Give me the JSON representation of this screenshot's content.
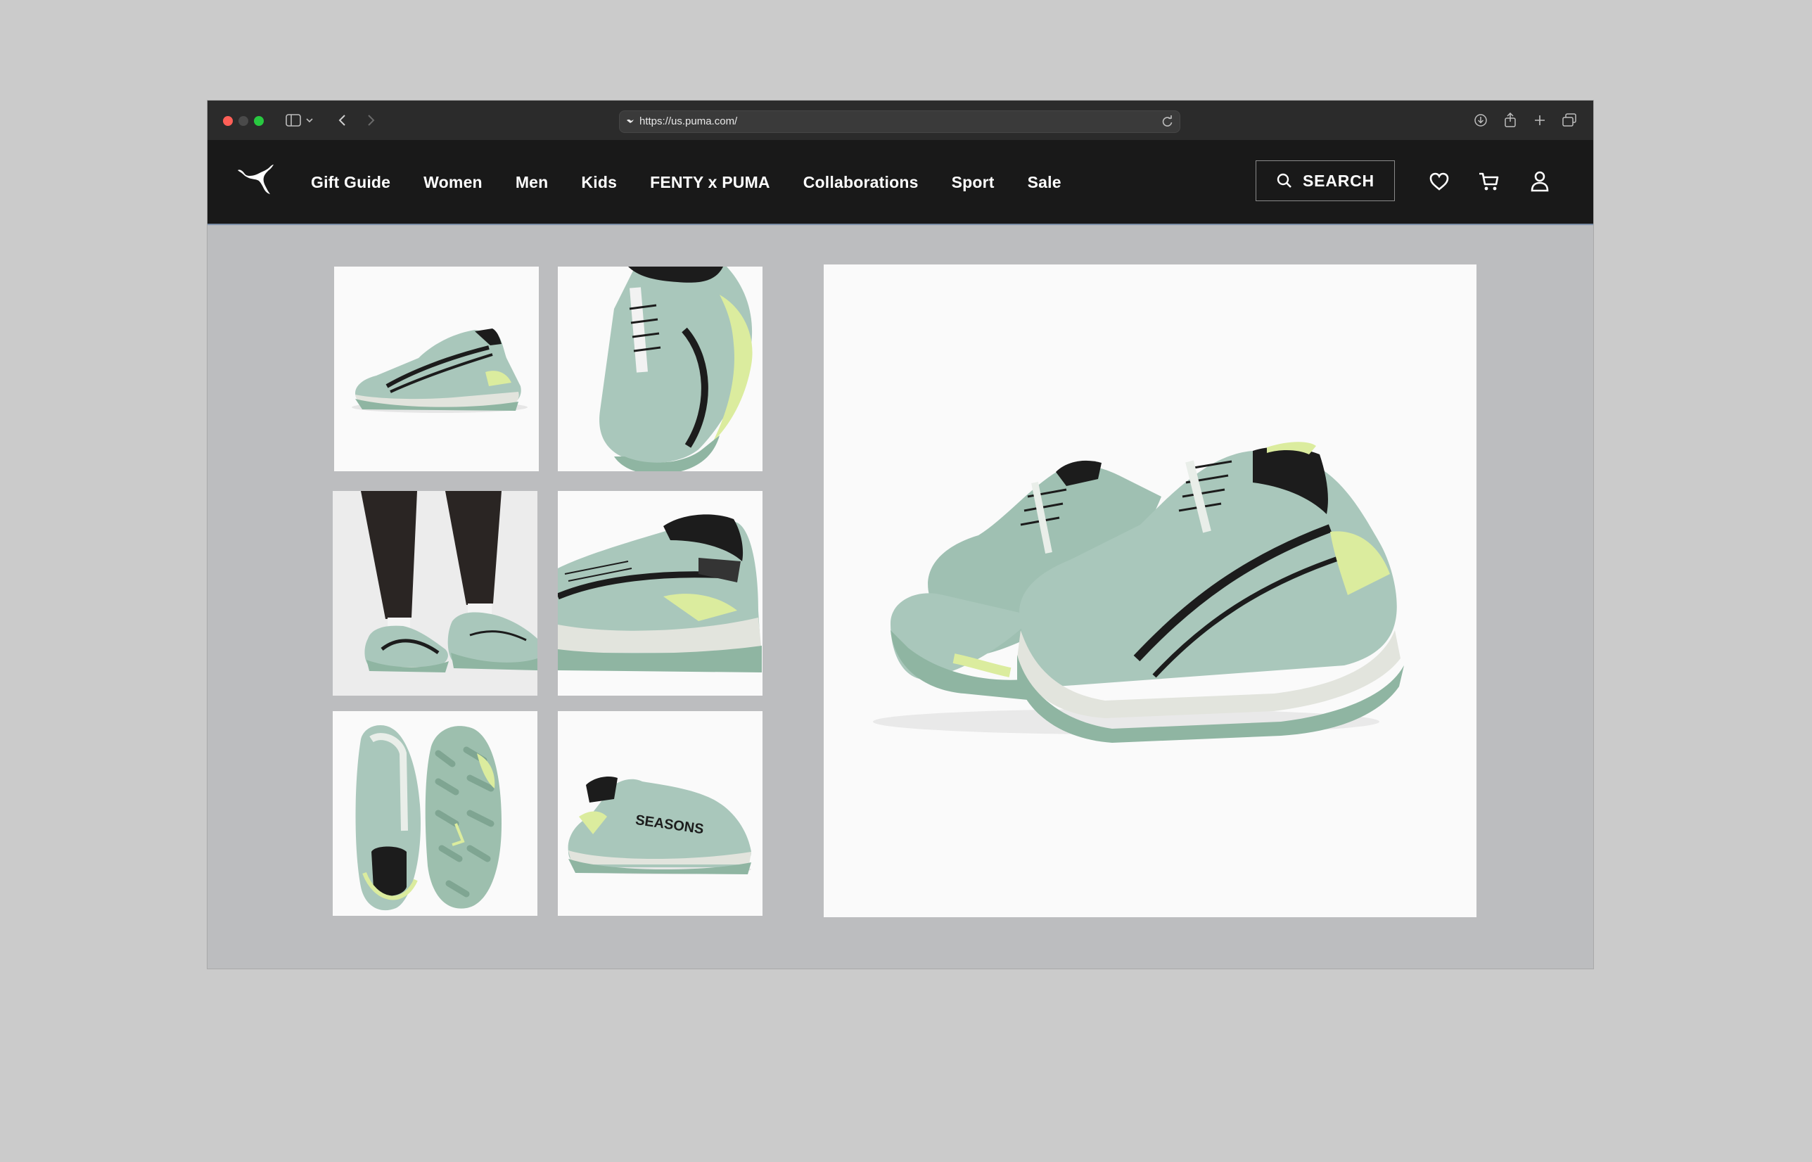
{
  "browser": {
    "url": "https://us.puma.com/"
  },
  "header": {
    "logo": "puma-logo",
    "nav": [
      {
        "label": "Gift Guide"
      },
      {
        "label": "Women"
      },
      {
        "label": "Men"
      },
      {
        "label": "Kids"
      },
      {
        "label": "FENTY x PUMA"
      },
      {
        "label": "Collaborations"
      },
      {
        "label": "Sport"
      },
      {
        "label": "Sale"
      }
    ],
    "search_label": "SEARCH",
    "icons": [
      "heart-icon",
      "cart-icon",
      "account-icon"
    ]
  },
  "gallery": {
    "thumbnails": [
      {
        "view": "side-left"
      },
      {
        "view": "top-front"
      },
      {
        "view": "on-feet"
      },
      {
        "view": "heel-rear"
      },
      {
        "view": "top-and-sole"
      },
      {
        "view": "side-right"
      }
    ],
    "main_view": "pair-front-three-quarter"
  },
  "colors": {
    "shoe_body": "#a9c7bb",
    "shoe_sole": "#e2e4dd",
    "outsole": "#8fb5a2",
    "accent_lime": "#dbec9e",
    "collar": "#1c1c1c",
    "header_bg": "#191919"
  }
}
